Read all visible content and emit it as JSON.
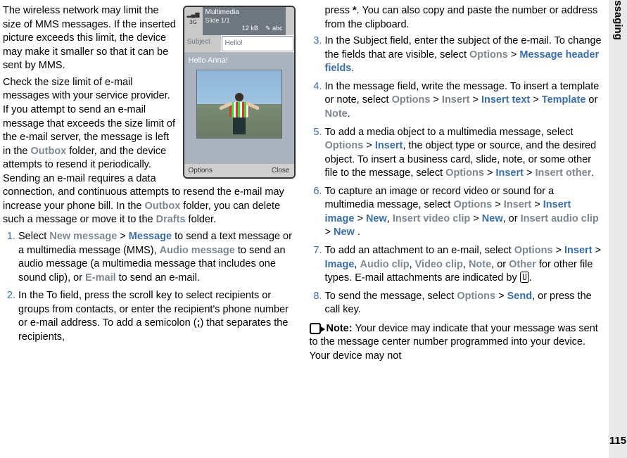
{
  "side": {
    "section": "Messaging",
    "page": "115"
  },
  "phone": {
    "network": "3G",
    "mm_title": "Multimedia",
    "slide": "Slide 1/1",
    "size": "12 kB",
    "input_mode": "✎ abc",
    "subject_label": "Subject",
    "subject_value": "Hello!",
    "body_text": "Hello Anna!",
    "soft_left": "Options",
    "soft_right": "Close"
  },
  "col1": {
    "p1a": "The wireless network may limit the size of MMS messages. If the inserted picture exceeds this limit, the device may make it smaller so that it can be sent by MMS.",
    "p2a": "Check the size limit of e-mail messages with your service provider. If you attempt to send an e-mail message that exceeds the size limit of the e-mail server, the message is left in the ",
    "p2_outbox1": "Outbox",
    "p2b": " folder, and the device attempts to resend it periodically. Sending an e-mail requires a data connection, and continuous attempts to resend the e-mail may increase your phone bill. In the ",
    "p2_outbox2": "Outbox",
    "p2c": " folder, you can delete such a message or move it to the ",
    "p2_drafts": "Drafts",
    "p2d": " folder.",
    "s1_a": "Select ",
    "s1_newmsg": "New message",
    "s1_b": "  >  ",
    "s1_msg": "Message",
    "s1_c": " to send a text message or a multimedia message (MMS), ",
    "s1_audio": "Audio message",
    "s1_d": " to send an audio message (a multimedia message that includes one sound clip), or ",
    "s1_email": "E-mail",
    "s1_e": " to send an e-mail.",
    "s2_a": "In the To field, press the scroll key to select recipients or groups from contacts, or enter the recipient's phone number or e-mail address. To add a semicolon (",
    "s2_semi": ";",
    "s2_b": ") that separates the recipients,"
  },
  "col2": {
    "s2_c": "press ",
    "s2_ast": "*",
    "s2_d": ". You can also copy and paste the number or address from the clipboard.",
    "s3_a": "In the Subject field, enter the subject of the e-mail. To change the fields that are visible, select ",
    "s3_opt": "Options",
    "gt": "  >  ",
    "s3_mhf": "Message header fields",
    "s3_b": ".",
    "s4_a": "In the message field, write the message. To insert a template or note, select ",
    "s4_opt": "Options",
    "s4_ins": "Insert",
    "s4_it": "Insert text",
    "s4_tpl": "Template",
    "s4_or": " or ",
    "s4_note": "Note",
    "s4_b": ".",
    "s5_a": "To add a media object to a multimedia message, select ",
    "s5_opt": "Options",
    "s5_ins": "Insert",
    "s5_b": ", the object type or source, and the desired object. To insert a business card, slide, note, or some other file to the message, select ",
    "s5_opt2": "Options",
    "s5_ins2": "Insert",
    "s5_io": "Insert other",
    "s5_c": ".",
    "s6_a": "To capture an image or record video or sound for a multimedia message, select ",
    "s6_opt": "Options",
    "s6_ins": "Insert",
    "s6_iimg": "Insert image",
    "s6_new1": "New",
    "s6_comma": ", ",
    "s6_ivid": "Insert video clip",
    "s6_new2": "New",
    "s6_or": ", or ",
    "s6_iaud": "Insert audio clip",
    "s6_new3": "New",
    "s6_b": " .",
    "s7_a": "To add an attachment to an e-mail, select ",
    "s7_opt": "Options",
    "s7_ins": "Insert",
    "s7_img": "Image",
    "s7_aud": "Audio clip",
    "s7_vid": "Video clip",
    "s7_note": "Note",
    "s7_or": ", or ",
    "s7_other": "Other",
    "s7_b": " for other file types. E-mail attachments are indicated by ",
    "s7_c": ".",
    "s8_a": "To send the message, select ",
    "s8_opt": "Options",
    "s8_send": "Send",
    "s8_b": ", or press the call key.",
    "note_label": "Note:  ",
    "note_text": "Your device may indicate that your message was sent to the message center number programmed into your device. Your device may not"
  }
}
